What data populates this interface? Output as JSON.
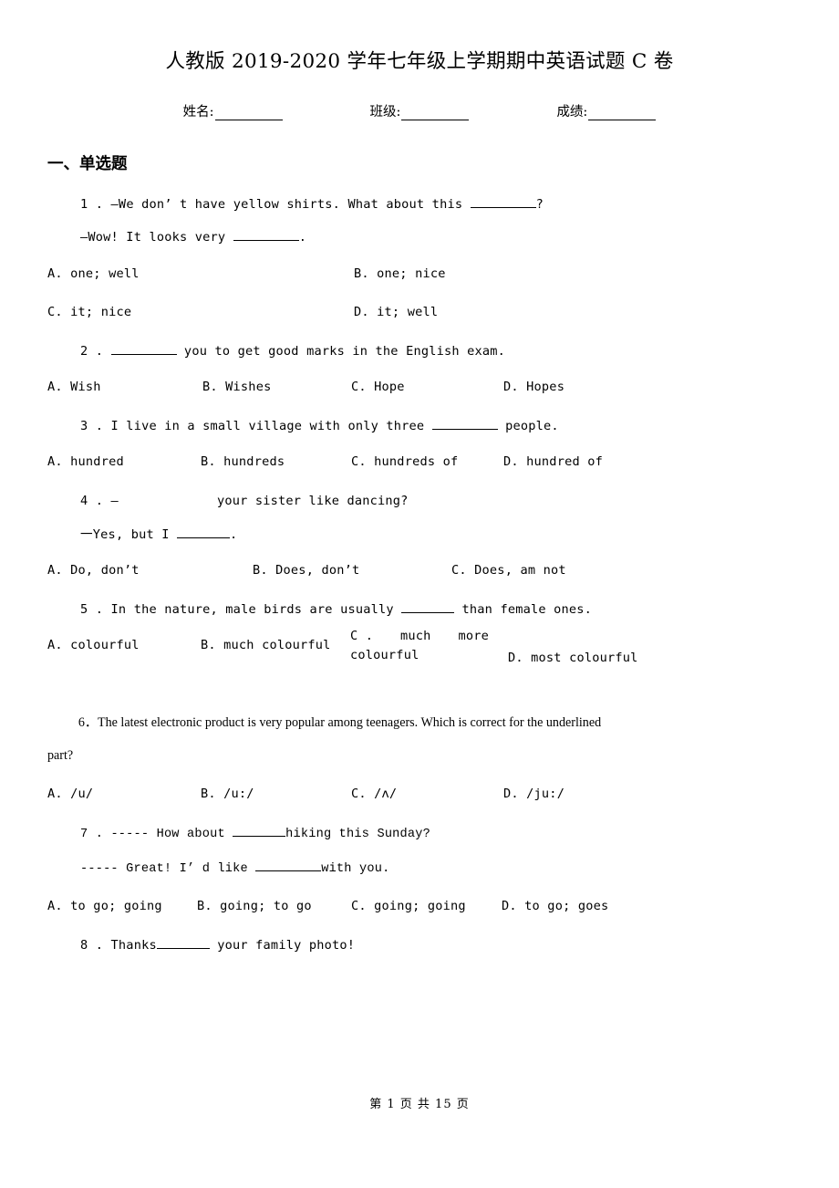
{
  "document": {
    "title": "人教版 2019-2020 学年七年级上学期期中英语试题 C 卷",
    "footer": "第 1 页 共 15 页"
  },
  "student_info": [
    {
      "label": "姓名:"
    },
    {
      "label": "班级:"
    },
    {
      "label": "成绩:"
    }
  ],
  "sections": [
    {
      "heading": "一、单选题"
    }
  ],
  "questions": [
    {
      "number": "1 .",
      "stem_line1_pre": "—We don’ t have yellow shirts. What about this ",
      "stem_line1_post": "?",
      "stem_line2_pre": "—Wow! It looks very ",
      "stem_line2_post": ".",
      "options": [
        "A. one; well",
        "B. one; nice",
        "C. it; nice",
        "D. it; well"
      ]
    },
    {
      "number": "2 .",
      "stem_pre": "",
      "stem_post": " you to get good marks in the English exam.",
      "options": [
        "A. Wish",
        "B. Wishes",
        "C. Hope",
        "D. Hopes"
      ]
    },
    {
      "number": "3 .",
      "stem_pre": " I live in a small village with only three ",
      "stem_post": " people.",
      "options": [
        "A. hundred",
        "B. hundreds",
        "C. hundreds of",
        "D. hundred of"
      ]
    },
    {
      "number": "4 .",
      "stem_line1_pre": "—",
      "stem_line1_post": "your sister like dancing?",
      "stem_line2_pre": "一Yes, but I ",
      "stem_line2_post": ".",
      "options": [
        "A. Do, don’t",
        "B. Does, don’t",
        "C. Does, am not"
      ]
    },
    {
      "number": "5 .",
      "stem_pre": " In the nature, male birds are usually ",
      "stem_post": " than female ones.",
      "options": [
        "A. colourful",
        "B. much colourful",
        "C .",
        "much",
        "more",
        "colourful",
        "D. most colourful"
      ]
    },
    {
      "number": "6 .",
      "stem_line1": "6．The latest electronic product is very popular among teenagers. Which is correct for the underlined",
      "stem_line2": "part?",
      "options": [
        "A. /u/",
        "B. /u:/",
        "C. /ʌ/",
        "D. /ju:/"
      ]
    },
    {
      "number": "7 .",
      "stem_line1_pre": "----- How about ",
      "stem_line1_post": "hiking this Sunday?",
      "stem_line2_pre": "----- Great! I’ d like ",
      "stem_line2_post": "with you.",
      "options": [
        "A. to go; going",
        "B. going; to go",
        "C. going; going",
        "D. to go; goes"
      ]
    },
    {
      "number": "8 .",
      "stem_pre": " Thanks",
      "stem_post": " your family photo!",
      "options": []
    }
  ]
}
